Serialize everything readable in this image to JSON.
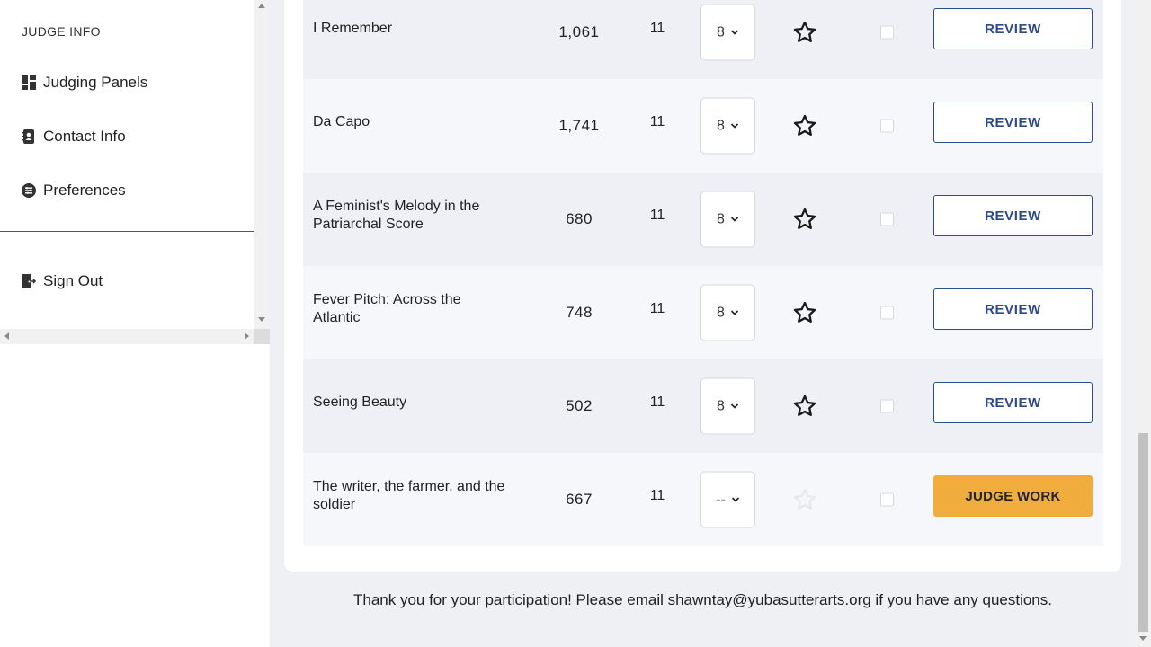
{
  "sidebar": {
    "header": "JUDGE INFO",
    "items": [
      {
        "label": "Judging Panels",
        "icon": "dashboard-icon"
      },
      {
        "label": "Contact Info",
        "icon": "contact-book-icon"
      },
      {
        "label": "Preferences",
        "icon": "preferences-icon"
      }
    ],
    "sign_out": {
      "label": "Sign Out",
      "icon": "sign-out-icon"
    }
  },
  "entries": [
    {
      "title": "I Remember",
      "words": "1,061",
      "round": "11",
      "score": "8",
      "starred": false,
      "action": "REVIEW"
    },
    {
      "title": "Da Capo",
      "words": "1,741",
      "round": "11",
      "score": "8",
      "starred": false,
      "action": "REVIEW"
    },
    {
      "title": "A Feminist's Melody in the Patriarchal Score",
      "words": "680",
      "round": "11",
      "score": "8",
      "starred": false,
      "action": "REVIEW"
    },
    {
      "title": "Fever Pitch: Across the Atlantic",
      "words": "748",
      "round": "11",
      "score": "8",
      "starred": false,
      "action": "REVIEW"
    },
    {
      "title": "Seeing Beauty",
      "words": "502",
      "round": "11",
      "score": "8",
      "starred": false,
      "action": "REVIEW"
    },
    {
      "title": "The writer, the farmer, and the soldier",
      "words": "667",
      "round": "11",
      "score": "--",
      "starred": false,
      "action": "JUDGE WORK"
    }
  ],
  "footer": "Thank you for your participation! Please email shawntay@yubasutterarts.org if you have any questions.",
  "colors": {
    "accent": "#2d4a8a",
    "judge_button": "#f0ad3e"
  }
}
